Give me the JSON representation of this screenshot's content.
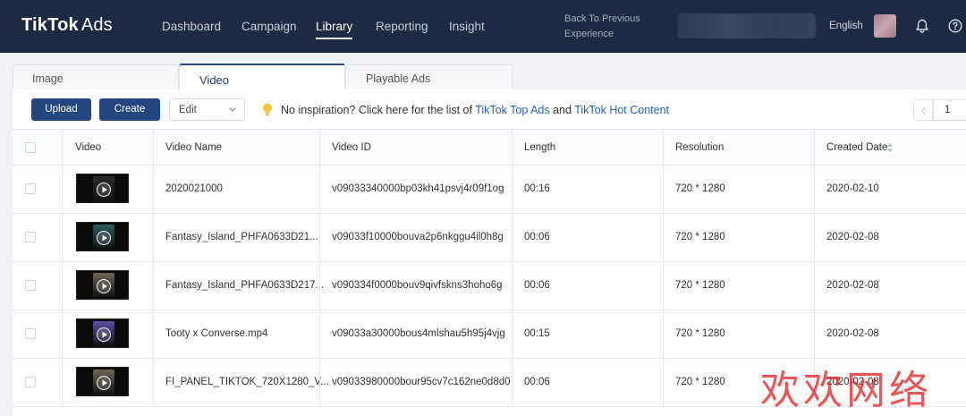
{
  "brand": {
    "logo_main": "TikTok",
    "logo_sub": "Ads"
  },
  "nav": {
    "items": [
      {
        "label": "Dashboard"
      },
      {
        "label": "Campaign"
      },
      {
        "label": "Library"
      },
      {
        "label": "Reporting"
      },
      {
        "label": "Insight"
      }
    ],
    "active": "Library",
    "back_line1": "Back To Previous",
    "back_line2": "Experience",
    "language": "English"
  },
  "tabs": [
    {
      "label": "Image"
    },
    {
      "label": "Video"
    },
    {
      "label": "Playable Ads"
    }
  ],
  "active_tab": "Video",
  "toolbar": {
    "upload_label": "Upload",
    "create_label": "Create",
    "edit_label": "Edit",
    "inspiration_text": "No inspiration? Click here for the list of",
    "link_top_ads": "TikTok Top Ads",
    "and_text": "and",
    "link_hot_content": "TikTok Hot Content",
    "page": "1"
  },
  "table": {
    "columns": [
      "Video",
      "Video Name",
      "Video ID",
      "Length",
      "Resolution",
      "Created Date"
    ],
    "rows": [
      {
        "name": "2020021000",
        "id": "v09033340000bp03kh41psvj4r09f1og",
        "length": "00:16",
        "resolution": "720 * 1280",
        "created": "2020-02-10",
        "thumb_color": "#2a2a2a"
      },
      {
        "name": "Fantasy_Island_PHFA0633D21...",
        "id": "v09033f10000bouva2p6nkggu4il0h8g",
        "length": "00:06",
        "resolution": "720 * 1280",
        "created": "2020-02-08",
        "thumb_color": "#2d5a5c"
      },
      {
        "name": "Fantasy_Island_PHFA0633D217...",
        "id": "v090334f0000bouv9qivfskns3hoho6g",
        "length": "00:06",
        "resolution": "720 * 1280",
        "created": "2020-02-08",
        "thumb_color": "#6b6554"
      },
      {
        "name": "Tooty x Converse.mp4",
        "id": "v09033a30000bous4mlshau5h95j4vjg",
        "length": "00:15",
        "resolution": "720 * 1280",
        "created": "2020-02-08",
        "thumb_color": "#5b4fa8"
      },
      {
        "name": "FI_PANEL_TIKTOK_720X1280_V...",
        "id": "v09033980000bour95cv7c162ne0d8d0",
        "length": "00:06",
        "resolution": "720 * 1280",
        "created": "2020-02-08",
        "thumb_color": "#6b6554"
      }
    ]
  },
  "watermark": "欢欢网络",
  "colors": {
    "topbar": "#1c2a42",
    "primary_button": "#24467f",
    "link": "#2a64b6",
    "watermark": "#e12828"
  }
}
